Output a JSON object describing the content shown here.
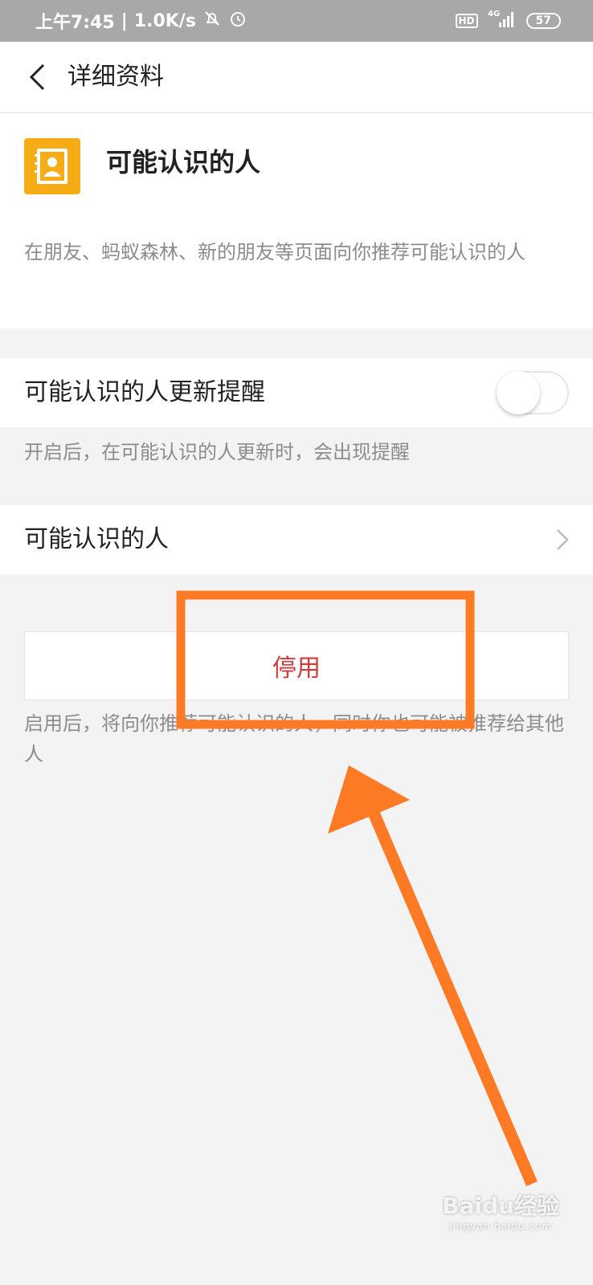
{
  "status_bar": {
    "time": "上午7:45",
    "speed": "1.0K/s",
    "hd": "HD",
    "network": "4G",
    "battery": "57"
  },
  "nav": {
    "title": "详细资料"
  },
  "header": {
    "title": "可能认识的人",
    "description": "在朋友、蚂蚁森林、新的朋友等页面向你推荐可能认识的人"
  },
  "reminder": {
    "label": "可能认识的人更新提醒",
    "toggle_on": false,
    "hint": "开启后，在可能认识的人更新时，会出现提醒"
  },
  "people_row": {
    "label": "可能认识的人"
  },
  "disable_button": {
    "label": "停用"
  },
  "footer_hint": "启用后，将向你推荐可能认识的人，同时你也可能被推荐给其他人",
  "watermark": {
    "brand": "Baidu经验",
    "url": "jingyan.baidu.com"
  },
  "colors": {
    "status_bar": "#a8a8a8",
    "accent_icon": "#f6ac15",
    "danger_text": "#d13a3a",
    "annotation": "#ff7a24"
  }
}
